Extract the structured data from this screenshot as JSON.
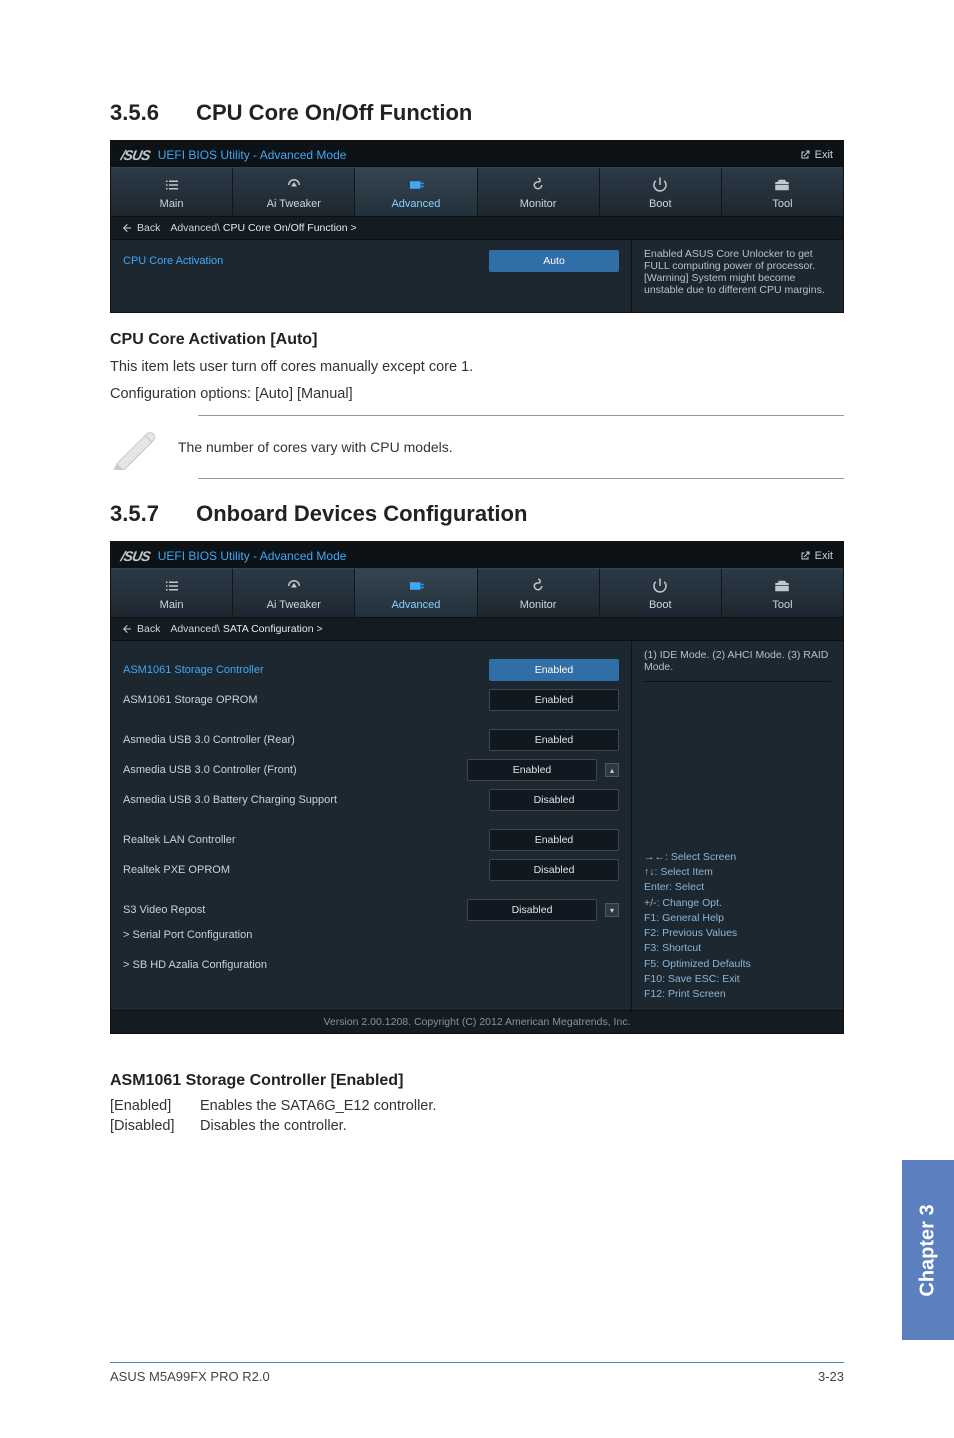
{
  "sections": {
    "s1": {
      "num": "3.5.6",
      "title": "CPU Core On/Off Function"
    },
    "s2": {
      "num": "3.5.7",
      "title": "Onboard Devices Configuration"
    }
  },
  "bios_common": {
    "logo": "/SUS",
    "title": "UEFI BIOS Utility - Advanced Mode",
    "exit": "Exit",
    "tabs": {
      "main": "Main",
      "tweaker": "Ai  Tweaker",
      "advanced": "Advanced",
      "monitor": "Monitor",
      "boot": "Boot",
      "tool": "Tool"
    },
    "back": "Back",
    "footer": "Version  2.00.1208.   Copyright  (C)  2012  American  Megatrends,  Inc."
  },
  "panel1": {
    "crumb_prefix": "Advanced\\ ",
    "crumb_bold": "CPU Core On/Off Function  >",
    "row_label": "CPU Core Activation",
    "row_value": "Auto",
    "help": "Enabled ASUS Core Unlocker to get FULL computing power of processor. [Warning] System might become unstable due to different CPU margins."
  },
  "doc1": {
    "h": "CPU Core Activation [Auto]",
    "p1": "This item lets user turn off cores manually except core 1.",
    "p2": "Configuration options: [Auto] [Manual]",
    "note": "The number of cores vary with CPU models."
  },
  "panel2": {
    "crumb_prefix": "Advanced\\ ",
    "crumb_bold": "SATA Configuration  >",
    "help_top": "(1) IDE Mode. (2) AHCI Mode. (3) RAID Mode.",
    "rows": {
      "r1": {
        "label": "ASM1061 Storage Controller",
        "value": "Enabled"
      },
      "r2": {
        "label": "ASM1061 Storage OPROM",
        "value": "Enabled"
      },
      "r3": {
        "label": "Asmedia USB 3.0 Controller (Rear)",
        "value": "Enabled"
      },
      "r4": {
        "label": "Asmedia USB 3.0 Controller (Front)",
        "value": "Enabled"
      },
      "r5": {
        "label": "Asmedia USB 3.0 Battery Charging Support",
        "value": "Disabled"
      },
      "r6": {
        "label": "Realtek LAN Controller",
        "value": "Enabled"
      },
      "r7": {
        "label": "Realtek PXE OPROM",
        "value": "Disabled"
      },
      "r8": {
        "label": "S3 Video Repost",
        "value": "Disabled"
      }
    },
    "subs": {
      "s1": "Serial Port Configuration",
      "s2": "SB HD Azalia Configuration"
    },
    "hints": {
      "l1": "→←:  Select Screen",
      "l2": "↑↓:  Select Item",
      "l3": "Enter:  Select",
      "l4": "+/-:  Change Opt.",
      "l5": "F1:  General Help",
      "l6": "F2:  Previous Values",
      "l7": "F3:  Shortcut",
      "l8": "F5:  Optimized Defaults",
      "l9": "F10:  Save    ESC:  Exit",
      "l10": "F12: Print Screen"
    }
  },
  "doc2": {
    "h": "ASM1061 Storage Controller [Enabled]",
    "enabled_k": "[Enabled]",
    "enabled_v": "Enables the SATA6G_E12 controller.",
    "disabled_k": "[Disabled]",
    "disabled_v": "Disables the controller."
  },
  "side_tab": "Chapter 3",
  "footer_left": "ASUS M5A99FX PRO R2.0",
  "footer_right": "3-23"
}
